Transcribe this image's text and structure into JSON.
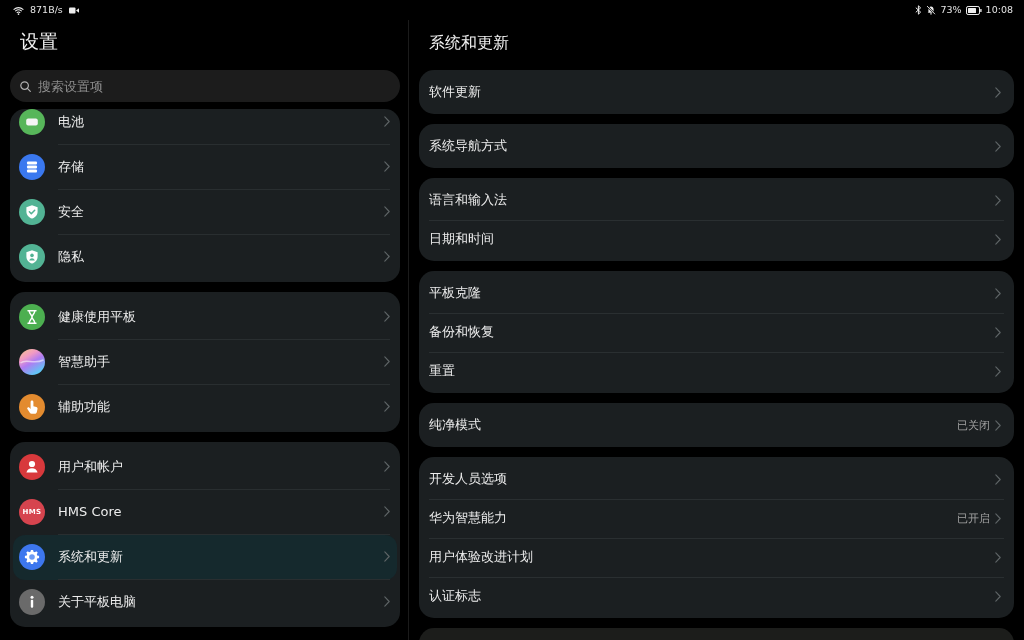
{
  "status_bar": {
    "net_speed": "871B/s",
    "battery": "73%",
    "time": "10:08"
  },
  "sidebar": {
    "title": "设置",
    "search": {
      "placeholder": "搜索设置项"
    },
    "groups": [
      {
        "items": [
          {
            "label": "电池",
            "selected": false
          },
          {
            "label": "存储",
            "selected": false
          },
          {
            "label": "安全",
            "selected": false
          },
          {
            "label": "隐私",
            "selected": false
          }
        ]
      },
      {
        "items": [
          {
            "label": "健康使用平板",
            "selected": false
          },
          {
            "label": "智慧助手",
            "selected": false
          },
          {
            "label": "辅助功能",
            "selected": false
          }
        ]
      },
      {
        "items": [
          {
            "label": "用户和帐户",
            "selected": false
          },
          {
            "label": "HMS Core",
            "logo_text": "HMS",
            "selected": false
          },
          {
            "label": "系统和更新",
            "selected": true
          },
          {
            "label": "关于平板电脑",
            "selected": false
          }
        ]
      }
    ]
  },
  "detail": {
    "title": "系统和更新",
    "groups": [
      {
        "items": [
          {
            "label": "软件更新"
          }
        ]
      },
      {
        "items": [
          {
            "label": "系统导航方式"
          }
        ]
      },
      {
        "items": [
          {
            "label": "语言和输入法"
          },
          {
            "label": "日期和时间"
          }
        ]
      },
      {
        "items": [
          {
            "label": "平板克隆"
          },
          {
            "label": "备份和恢复"
          },
          {
            "label": "重置"
          }
        ]
      },
      {
        "items": [
          {
            "label": "纯净模式",
            "value": "已关闭"
          }
        ]
      },
      {
        "items": [
          {
            "label": "开发人员选项"
          },
          {
            "label": "华为智慧能力",
            "value": "已开启"
          },
          {
            "label": "用户体验改进计划"
          },
          {
            "label": "认证标志"
          }
        ]
      }
    ]
  }
}
